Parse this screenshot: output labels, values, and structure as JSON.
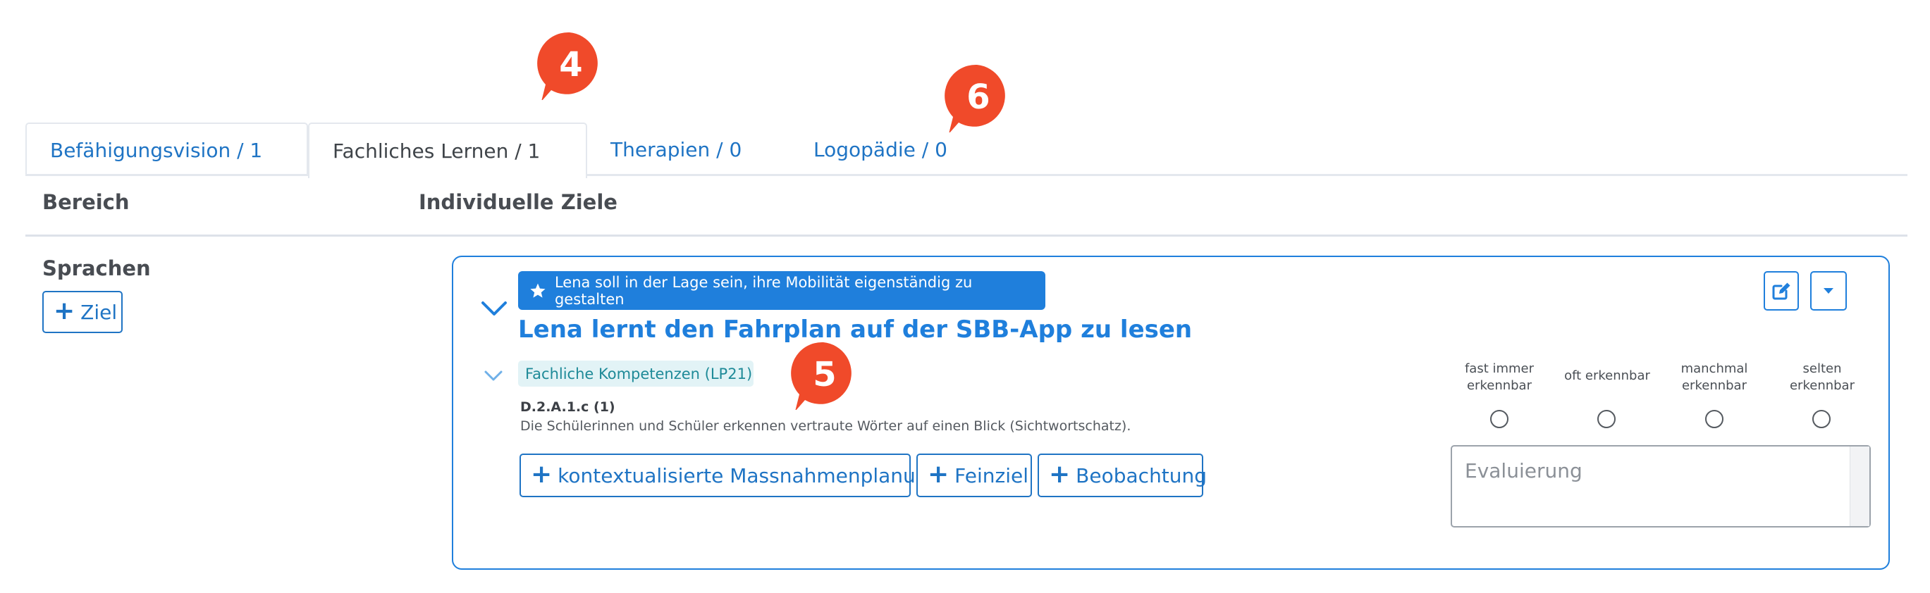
{
  "tabs": [
    {
      "label": "Befähigungsvision / 1"
    },
    {
      "label": "Fachliches Lernen / 1"
    },
    {
      "label": "Therapien / 0"
    },
    {
      "label": "Logopädie / 0"
    }
  ],
  "table": {
    "col_bereich": "Bereich",
    "col_ziele": "Individuelle Ziele"
  },
  "bereich": {
    "name": "Sprachen",
    "add_goal_label": "Ziel"
  },
  "goal": {
    "vision_badge": "Lena soll in der Lage sein, ihre Mobilität eigenständig zu gestalten",
    "title": "Lena lernt den Fahrplan auf der SBB-App zu lesen",
    "competence_badge": "Fachliche Kompetenzen (LP21)",
    "competence_code": "D.2.A.1.c (1)",
    "competence_desc": "Die Schülerinnen und Schüler erkennen vertraute Wörter auf einen Blick (Sichtwortschatz).",
    "actions": {
      "massnahmen": "kontextualisierte Massnahmenplanung",
      "feinziel": "Feinziel",
      "beobachtung": "Beobachtung"
    }
  },
  "rating": {
    "options": [
      {
        "line1": "fast immer",
        "line2": "erkennbar"
      },
      {
        "line1": "oft erkennbar",
        "line2": ""
      },
      {
        "line1": "manchmal",
        "line2": "erkennbar"
      },
      {
        "line1": "selten",
        "line2": "erkennbar"
      }
    ],
    "eval_placeholder": "Evaluierung"
  },
  "callouts": {
    "a": "4",
    "b": "5",
    "c": "6"
  },
  "colors": {
    "accent": "#1f7fdc",
    "link": "#1f74c4",
    "callout": "#f04a2a",
    "badge_bg": "#e2f3f6"
  }
}
